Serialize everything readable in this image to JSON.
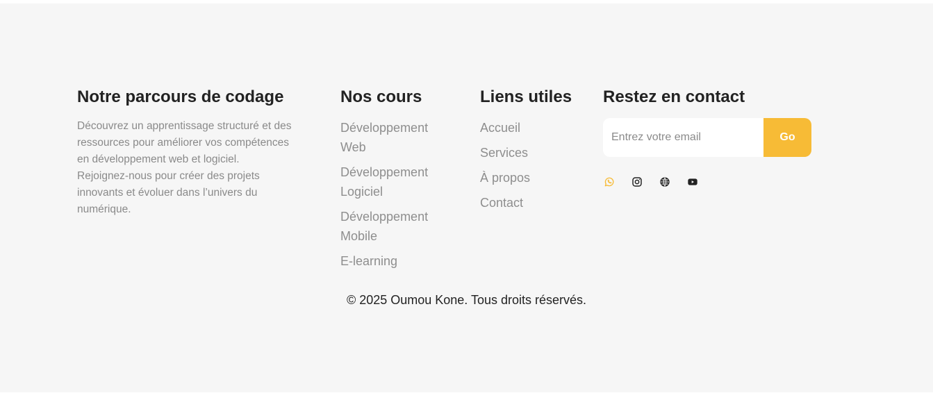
{
  "about": {
    "title": "Notre parcours de codage",
    "description": "Découvrez un apprentissage structuré et des ressources pour améliorer vos compétences en développement web et logiciel. Rejoignez-nous pour créer des projets innovants et évoluer dans l’univers du numérique."
  },
  "courses": {
    "title": "Nos cours",
    "items": [
      {
        "label": "Développement Web"
      },
      {
        "label": "Développement Logiciel"
      },
      {
        "label": "Développement Mobile"
      },
      {
        "label": "E-learning"
      }
    ]
  },
  "links": {
    "title": "Liens utiles",
    "items": [
      {
        "label": "Accueil"
      },
      {
        "label": "Services"
      },
      {
        "label": "À propos"
      },
      {
        "label": "Contact"
      }
    ]
  },
  "contact": {
    "title": "Restez en contact",
    "email_placeholder": "Entrez votre email",
    "email_value": "",
    "submit_label": "Go",
    "socials": [
      {
        "icon": "whatsapp-icon",
        "color": "#f7bb36"
      },
      {
        "icon": "instagram-icon",
        "color": "#222222"
      },
      {
        "icon": "globe-icon",
        "color": "#222222"
      },
      {
        "icon": "youtube-icon",
        "color": "#222222"
      }
    ]
  },
  "footer": {
    "copyright": "© 2025 Oumou Kone. Tous droits réservés."
  },
  "colors": {
    "background": "#f6f6f6",
    "accent": "#f7bb36",
    "heading": "#222222",
    "muted": "#8a8a8a"
  }
}
